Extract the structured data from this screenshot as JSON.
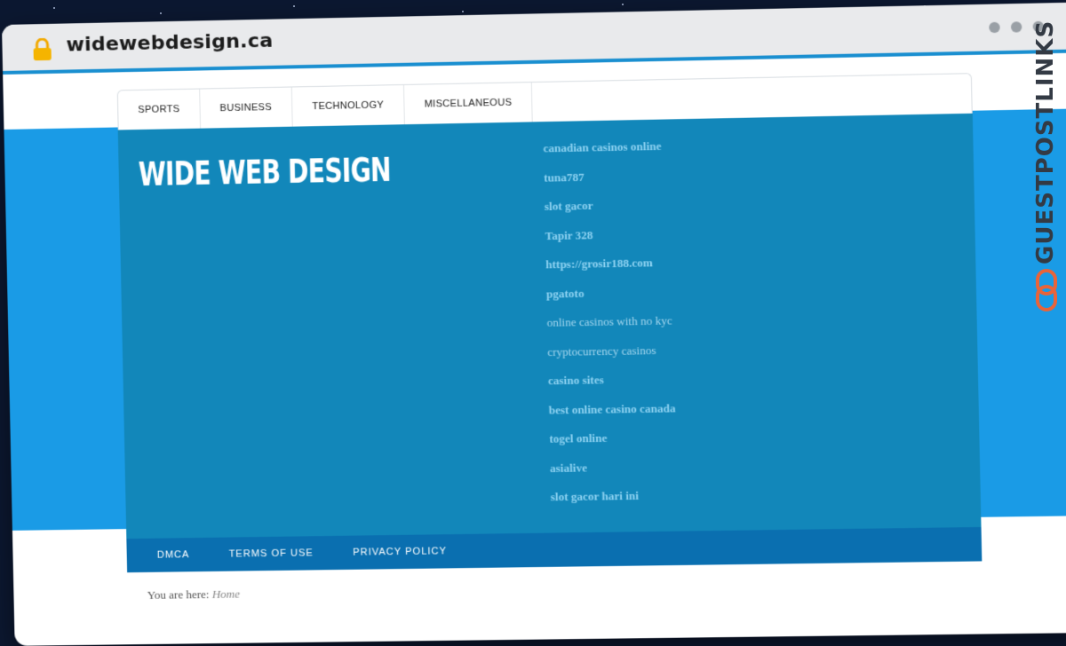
{
  "browser": {
    "url": "widewebdesign.ca"
  },
  "nav": {
    "items": [
      "SPORTS",
      "BUSINESS",
      "TECHNOLOGY",
      "MISCELLANEOUS"
    ]
  },
  "site": {
    "logo": "WIDE WEB DESIGN"
  },
  "links": [
    {
      "text": "canadian casinos online",
      "style": "bold"
    },
    {
      "text": "tuna787",
      "style": "bold"
    },
    {
      "text": "slot gacor",
      "style": "bold"
    },
    {
      "text": "Tapir 328",
      "style": "bold"
    },
    {
      "text": "https://grosir188.com",
      "style": "bold"
    },
    {
      "text": "pgatoto",
      "style": "bold"
    },
    {
      "text": "online casinos with no kyc",
      "style": "light"
    },
    {
      "text": "cryptocurrency casinos",
      "style": "light"
    },
    {
      "text": "casino sites",
      "style": "bold"
    },
    {
      "text": "best online casino canada",
      "style": "bold"
    },
    {
      "text": "togel online",
      "style": "bold"
    },
    {
      "text": "asialive",
      "style": "bold"
    },
    {
      "text": "slot gacor hari ini",
      "style": "bold"
    }
  ],
  "footer_nav": {
    "items": [
      "DMCA",
      "TERMS OF USE",
      "PRIVACY POLICY"
    ]
  },
  "breadcrumb": {
    "prefix": "You are here:",
    "current": "Home"
  },
  "brand_tag": {
    "text": "GUESTPOSTLINKS"
  },
  "colors": {
    "accent": "#1a9be6",
    "header": "#1287ba",
    "footer_nav": "#0a6fb0",
    "link": "#8fd3f2",
    "brand_orange": "#e8643a"
  }
}
